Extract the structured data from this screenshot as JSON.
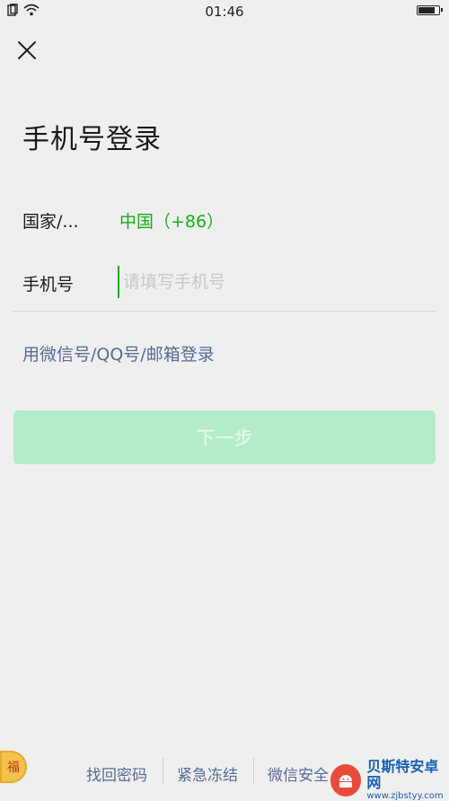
{
  "status_bar": {
    "time": "01:46",
    "battery_level": 0.85,
    "icons": [
      "sim-icon",
      "wifi-icon",
      "battery-icon"
    ]
  },
  "header": {
    "close_icon": "close-icon",
    "title": "手机号登录"
  },
  "form": {
    "country_label": "国家/...",
    "country_value": "中国（+86）",
    "phone_label": "手机号",
    "phone_placeholder": "请填写手机号",
    "phone_value": ""
  },
  "alt_login": "用微信号/QQ号/邮箱登录",
  "next_button": "下一步",
  "footer": {
    "links": [
      "找回密码",
      "紧急冻结",
      "微信安全"
    ]
  },
  "badge": {
    "text": "福"
  },
  "watermark": {
    "title": "贝斯特安卓网",
    "url": "www.zjbstyy.com"
  },
  "colors": {
    "accent_green": "#1aad19",
    "link_blue": "#576b95",
    "button_disabled": "#b4ecc9",
    "background": "#efefef"
  }
}
